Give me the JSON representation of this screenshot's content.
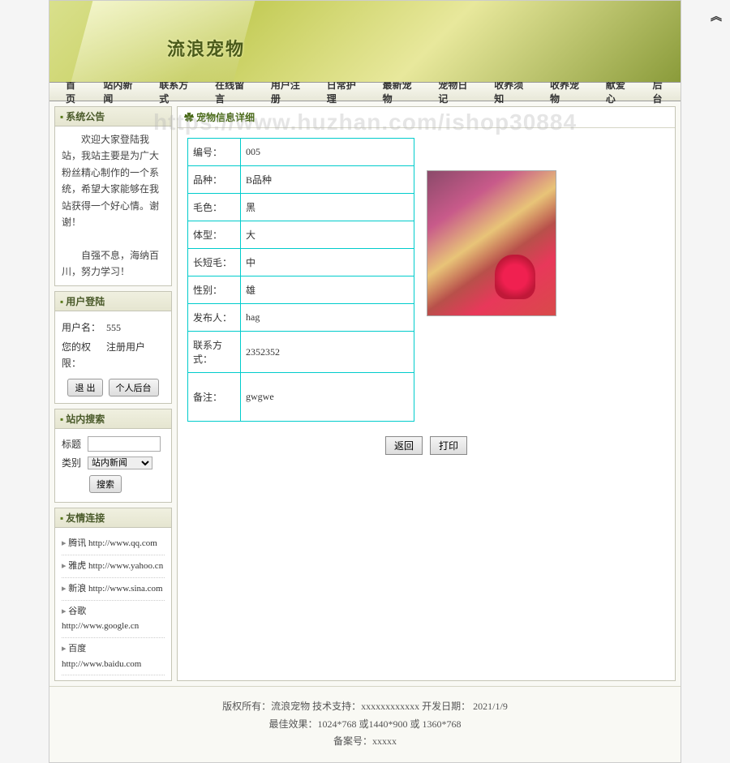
{
  "watermark": "https://www.huzhan.com/ishop30884",
  "banner_title": "流浪宠物",
  "nav": [
    "首页",
    "站内新闻",
    "联系方式",
    "在线留言",
    "用户注册",
    "日常护理",
    "最新宠物",
    "宠物日记",
    "收养须知",
    "收养宠物",
    "献爱心",
    "后台"
  ],
  "sidebar": {
    "notice_title": "系统公告",
    "notice_1": "欢迎大家登陆我站，我站主要是为广大粉丝精心制作的一个系统，希望大家能够在我站获得一个好心情。谢谢！",
    "notice_2": "自强不息，海纳百川，努力学习！",
    "login_title": "用户登陆",
    "login_user_label": "用户名：",
    "login_user_value": "555",
    "login_perm_label": "您的权限：",
    "login_perm_value": "注册用户",
    "logout_btn": "退 出",
    "ucenter_btn": "个人后台",
    "search_title": "站内搜索",
    "search_label_title": "标题",
    "search_label_type": "类别",
    "search_type_option": "站内新闻",
    "search_btn": "搜索",
    "links_title": "友情连接",
    "links": [
      {
        "name": "腾讯",
        "url": "http://www.qq.com"
      },
      {
        "name": "雅虎",
        "url": "http://www.yahoo.cn"
      },
      {
        "name": "新浪",
        "url": "http://www.sina.com"
      },
      {
        "name": "谷歌",
        "url": "http://www.google.cn"
      },
      {
        "name": "百度",
        "url": "http://www.baidu.com"
      }
    ]
  },
  "content": {
    "title": "宠物信息详细",
    "rows": [
      {
        "label": "编号：",
        "value": "005"
      },
      {
        "label": "品种：",
        "value": "B品种"
      },
      {
        "label": "毛色：",
        "value": "黑"
      },
      {
        "label": "体型：",
        "value": "大"
      },
      {
        "label": "长短毛：",
        "value": "中"
      },
      {
        "label": "性别：",
        "value": "雄"
      },
      {
        "label": "发布人：",
        "value": "hag"
      },
      {
        "label": "联系方式：",
        "value": "2352352"
      },
      {
        "label": "备注：",
        "value": "gwgwe"
      }
    ],
    "back_btn": "返回",
    "print_btn": "打印"
  },
  "footer": {
    "line1": "版权所有：流浪宠物 技术支持：xxxxxxxxxxxx 开发日期： 2021/1/9",
    "line2": "最佳效果：1024*768 或1440*900 或 1360*768",
    "line3": "备案号：xxxxx"
  }
}
